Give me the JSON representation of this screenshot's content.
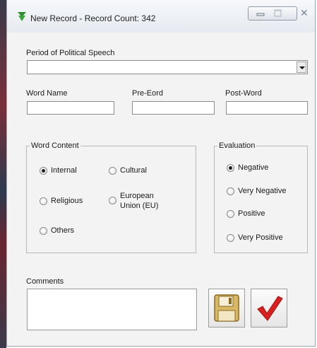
{
  "window": {
    "title": "New Record - Record Count: 342",
    "close_glyph": "✕",
    "colors": {
      "title_icon": "#2e8b2e",
      "check": "#d8201c",
      "disk": "#c8a24a"
    }
  },
  "form": {
    "period_label": "Period of Political Speech",
    "period_value": "",
    "word_name_label": "Word Name",
    "pre_word_label": "Pre-Eord",
    "post_word_label": "Post-Word",
    "word_name_value": "",
    "pre_word_value": "",
    "post_word_value": ""
  },
  "word_content": {
    "legend": "Word Content",
    "options": [
      {
        "label": "Internal",
        "checked": true
      },
      {
        "label": "Cultural",
        "checked": false
      },
      {
        "label": "Religious",
        "checked": false
      },
      {
        "label": "European",
        "label2": "Union (EU)",
        "checked": false
      },
      {
        "label": "Others",
        "checked": false
      }
    ]
  },
  "evaluation": {
    "legend": "Evaluation",
    "options": [
      {
        "label": "Negative",
        "checked": true
      },
      {
        "label": "Very Negative",
        "checked": false
      },
      {
        "label": "Positive",
        "checked": false
      },
      {
        "label": "Very Positive",
        "checked": false
      }
    ]
  },
  "comments": {
    "label": "Comments",
    "value": ""
  },
  "icons": {
    "save": "floppy-disk-icon",
    "confirm": "checkmark-icon"
  }
}
